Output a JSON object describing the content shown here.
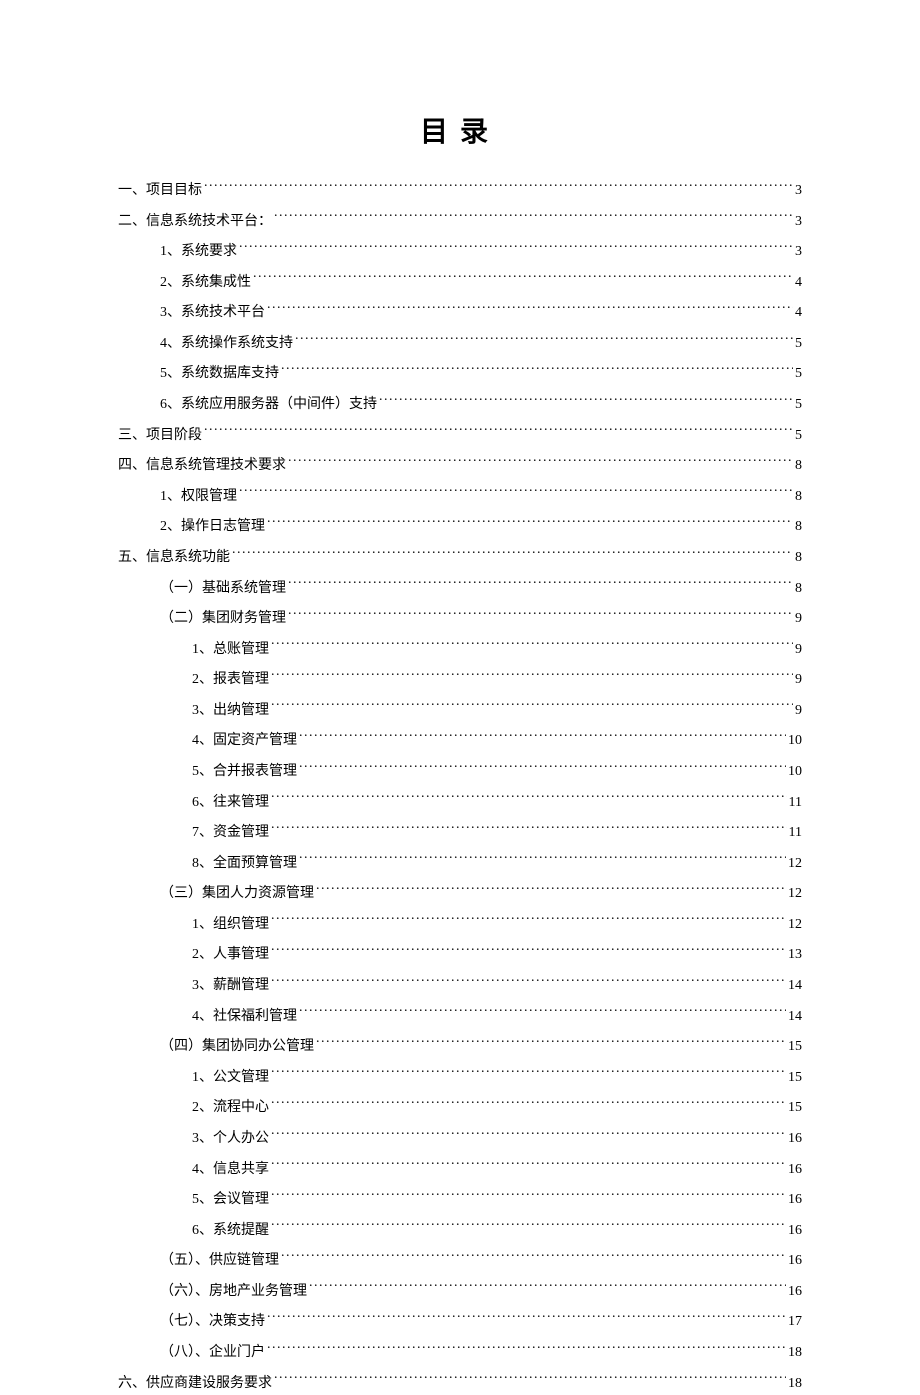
{
  "title": "目录",
  "toc": [
    {
      "label": "一、项目目标",
      "page": "3",
      "level": 0
    },
    {
      "label": "二、信息系统技术平台：",
      "page": "3",
      "level": 0
    },
    {
      "label": "1、系统要求",
      "page": "3",
      "level": 1
    },
    {
      "label": "2、系统集成性",
      "page": "4",
      "level": 1
    },
    {
      "label": "3、系统技术平台",
      "page": "4",
      "level": 1
    },
    {
      "label": "4、系统操作系统支持",
      "page": "5",
      "level": 1
    },
    {
      "label": "5、系统数据库支持",
      "page": "5",
      "level": 1
    },
    {
      "label": "6、系统应用服务器（中间件）支持",
      "page": "5",
      "level": 1
    },
    {
      "label": "三、项目阶段",
      "page": "5",
      "level": 0
    },
    {
      "label": "四、信息系统管理技术要求",
      "page": "8",
      "level": 0
    },
    {
      "label": "1、权限管理",
      "page": "8",
      "level": 1
    },
    {
      "label": "2、操作日志管理",
      "page": "8",
      "level": 1
    },
    {
      "label": "五、信息系统功能",
      "page": "8",
      "level": 0
    },
    {
      "label": "（一）基础系统管理",
      "page": "8",
      "level": 2
    },
    {
      "label": "（二）集团财务管理",
      "page": "9",
      "level": 2
    },
    {
      "label": "1、总账管理",
      "page": "9",
      "level": 3
    },
    {
      "label": "2、报表管理",
      "page": "9",
      "level": 3
    },
    {
      "label": "3、出纳管理",
      "page": "9",
      "level": 3
    },
    {
      "label": "4、固定资产管理",
      "page": "10",
      "level": 3
    },
    {
      "label": "5、合并报表管理",
      "page": "10",
      "level": 3
    },
    {
      "label": "6、往来管理",
      "page": "11",
      "level": 3
    },
    {
      "label": "7、资金管理",
      "page": "11",
      "level": 3
    },
    {
      "label": "8、全面预算管理",
      "page": "12",
      "level": 3
    },
    {
      "label": "（三）集团人力资源管理",
      "page": "12",
      "level": 2
    },
    {
      "label": "1、组织管理",
      "page": "12",
      "level": 3
    },
    {
      "label": "2、人事管理",
      "page": "13",
      "level": 3
    },
    {
      "label": "3、薪酬管理",
      "page": "14",
      "level": 3
    },
    {
      "label": "4、社保福利管理",
      "page": "14",
      "level": 3
    },
    {
      "label": "（四）集团协同办公管理",
      "page": "15",
      "level": 2
    },
    {
      "label": "1、公文管理",
      "page": "15",
      "level": 3
    },
    {
      "label": "2、流程中心",
      "page": "15",
      "level": 3
    },
    {
      "label": "3、个人办公",
      "page": "16",
      "level": 3
    },
    {
      "label": "4、信息共享",
      "page": "16",
      "level": 3
    },
    {
      "label": "5、会议管理",
      "page": "16",
      "level": 3
    },
    {
      "label": "6、系统提醒",
      "page": "16",
      "level": 3
    },
    {
      "label": "（五）、供应链管理",
      "page": "16",
      "level": 2
    },
    {
      "label": "（六）、房地产业务管理",
      "page": "16",
      "level": 2
    },
    {
      "label": "（七）、决策支持",
      "page": "17",
      "level": 2
    },
    {
      "label": "（八）、企业门户",
      "page": "18",
      "level": 2
    },
    {
      "label": "六、供应商建设服务要求",
      "page": "18",
      "level": 0
    }
  ]
}
